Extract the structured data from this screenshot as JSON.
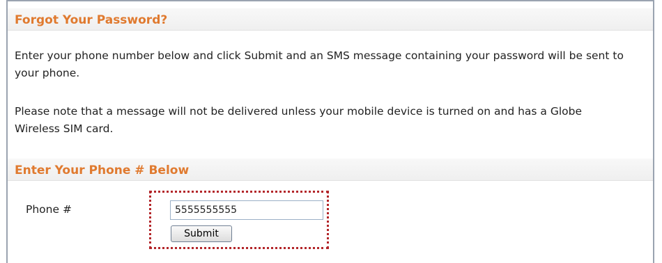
{
  "forgot_section": {
    "title": "Forgot Your Password?",
    "instructions": "Enter your phone number below and click Submit and an SMS message containing your password will be sent to your phone.",
    "note": "Please note that a message will not be delivered unless your mobile device is turned on and has a Globe Wireless SIM card."
  },
  "phone_section": {
    "title": "Enter Your Phone # Below",
    "phone_label": "Phone #",
    "phone_value": "5555555555",
    "submit_label": "Submit"
  },
  "colors": {
    "heading": "#e07a2f",
    "highlight_border": "#b3262a"
  }
}
